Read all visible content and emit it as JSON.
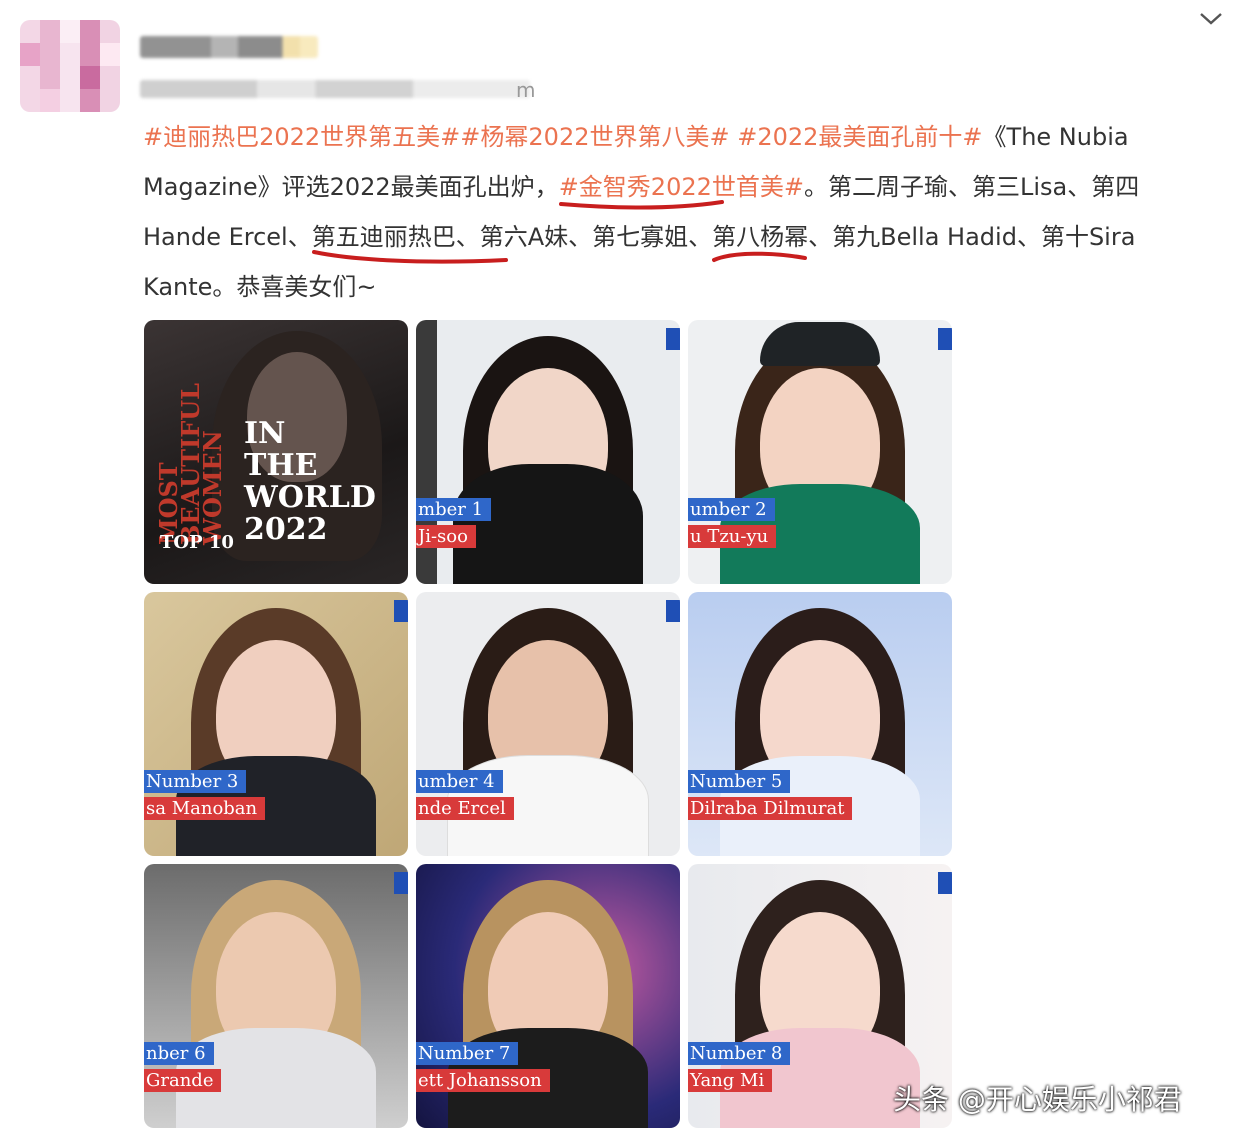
{
  "post": {
    "author_blurred": true,
    "meta_suffix": "m",
    "hashtags": [
      "#迪丽热巴2022世界第五美#",
      "#杨幂2022世界第八美#",
      "#2022最美面孔前十#",
      "#金智秀2022世首美#"
    ],
    "text_1": "《The Nubia Magazine》评选2022最美面孔出炉，",
    "text_2": "。第二周子瑜、第三Lisa、第四Hande Ercel、",
    "highlight_5": "第五迪丽热巴",
    "text_3": "、第六A妹、第七寡姐、",
    "highlight_8": "第八杨幂",
    "text_4": "、第九Bella Hadid、第十Sira Kante。恭喜美女们~"
  },
  "gallery": {
    "cover": {
      "side_text_1": "MOST",
      "side_text_2": "BEAUTIFUL",
      "side_text_3": "WOMEN",
      "top10": "TOP 10",
      "title_1": "IN",
      "title_2": "THE",
      "title_3": "WORLD",
      "title_4": "2022"
    },
    "tiles": [
      {
        "number": "mber 1",
        "name": "Ji-soo"
      },
      {
        "number": "umber 2",
        "name": "u Tzu-yu"
      },
      {
        "number": "Number 3",
        "name": "sa Manoban"
      },
      {
        "number": "umber 4",
        "name": "nde Ercel"
      },
      {
        "number": "Number 5",
        "name": "Dilraba Dilmurat"
      },
      {
        "number": "nber 6",
        "name": "Grande"
      },
      {
        "number": "Number 7",
        "name": "ett Johansson"
      },
      {
        "number": "Number 8",
        "name": "Yang Mi"
      }
    ]
  },
  "watermark": "头条 @开心娱乐小祁君",
  "colors": {
    "hashtag": "#eb7350",
    "underline": "#c81e1e",
    "label_blue": "#2f67c9",
    "label_red": "#d83a3a"
  },
  "icons": {
    "menu": "chevron-down-icon"
  }
}
